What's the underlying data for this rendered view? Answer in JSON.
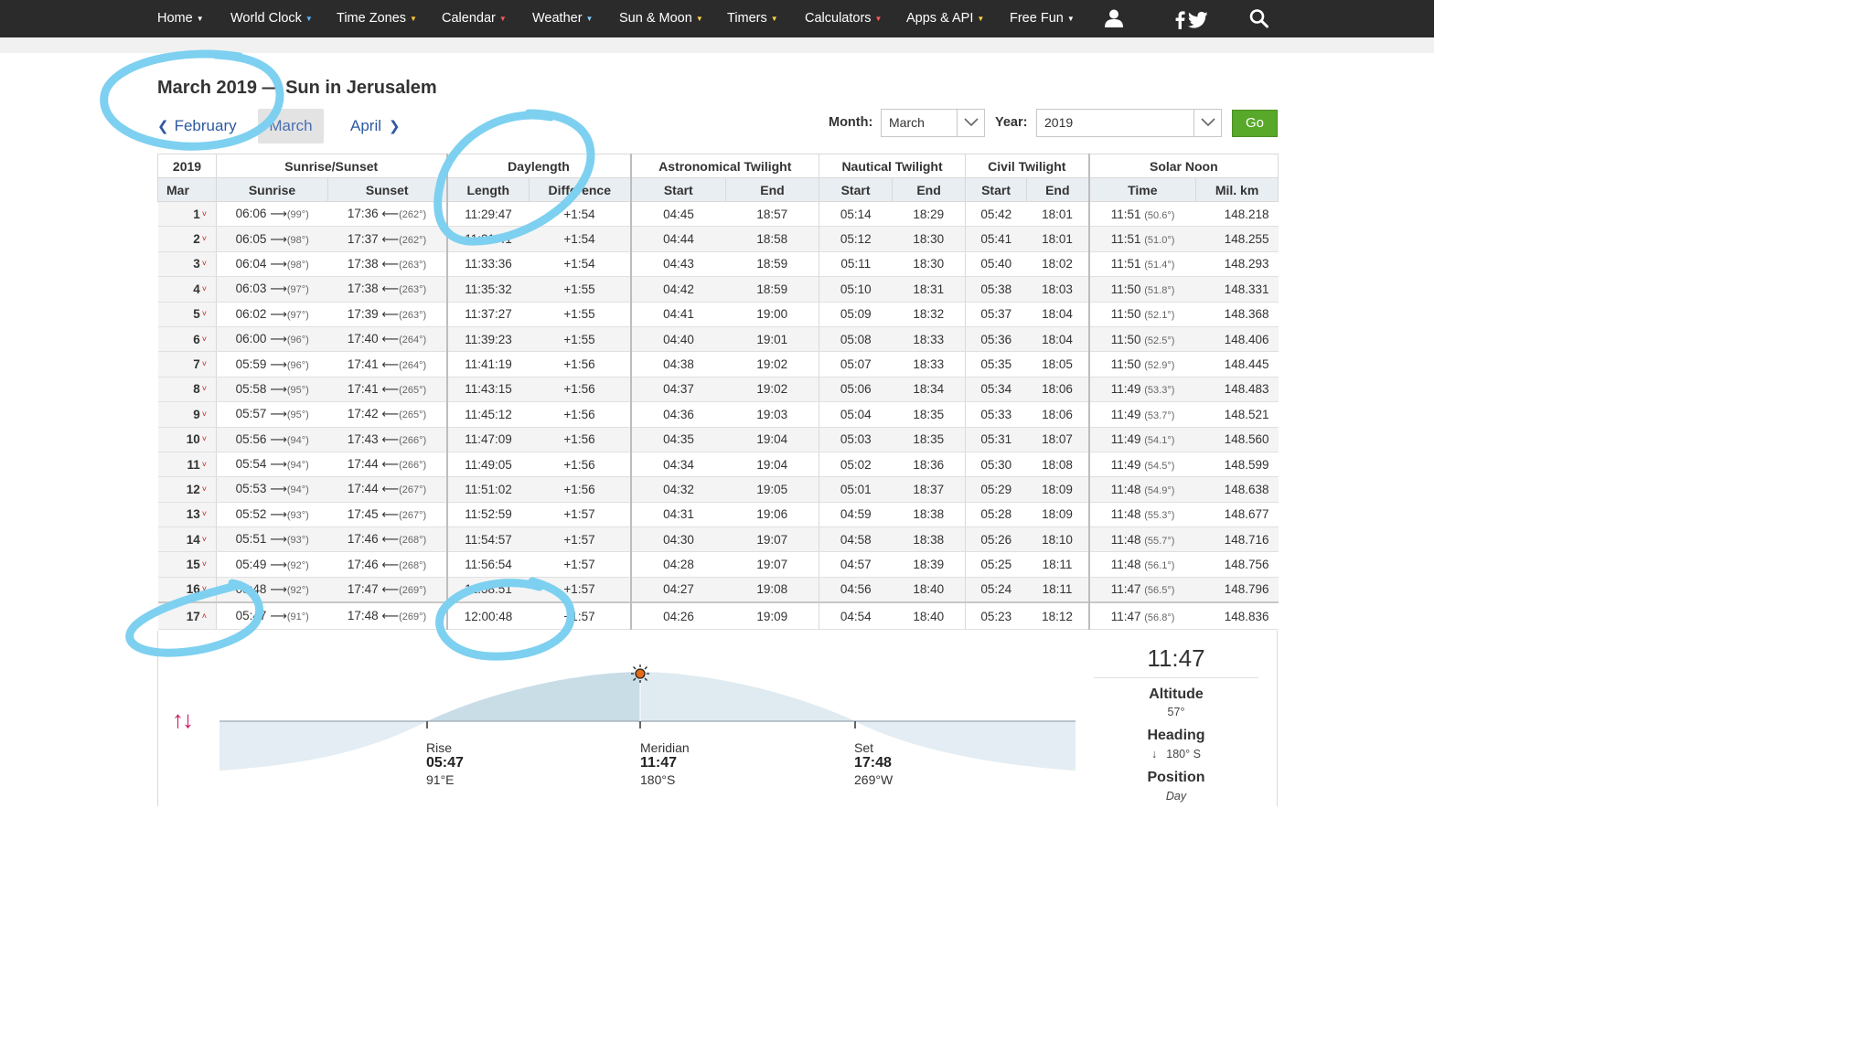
{
  "nav": {
    "items": [
      {
        "label": "Home"
      },
      {
        "label": "World Clock"
      },
      {
        "label": "Time Zones"
      },
      {
        "label": "Calendar"
      },
      {
        "label": "Weather"
      },
      {
        "label": "Sun & Moon"
      },
      {
        "label": "Timers"
      },
      {
        "label": "Calculators"
      },
      {
        "label": "Apps & API"
      },
      {
        "label": "Free Fun"
      }
    ],
    "icons": [
      "user-icon",
      "facebook-icon",
      "twitter-icon",
      "search-icon"
    ]
  },
  "header": {
    "title": "March 2019 — Sun in Jerusalem",
    "prev_month": "February",
    "current_month": "March",
    "next_month": "April"
  },
  "form": {
    "month_label": "Month:",
    "month_value": "March",
    "year_label": "Year:",
    "year_value": "2019",
    "go_label": "Go",
    "accent_color": "#58a829"
  },
  "table": {
    "group_headers": {
      "year": "2019",
      "sunrise_sunset": "Sunrise/Sunset",
      "daylength": "Daylength",
      "astro": "Astronomical Twilight",
      "nautical": "Nautical Twilight",
      "civil": "Civil Twilight",
      "solar_noon": "Solar Noon"
    },
    "sub_headers": {
      "month": "Mar",
      "sunrise": "Sunrise",
      "sunset": "Sunset",
      "length": "Length",
      "difference": "Difference",
      "astro_start": "Start",
      "astro_end": "End",
      "naut_start": "Start",
      "naut_end": "End",
      "civil_start": "Start",
      "civil_end": "End",
      "noon_time": "Time",
      "mil_km": "Mil. km"
    },
    "rows": [
      {
        "day": "1",
        "rise": "06:06",
        "rise_az": "(99°)",
        "set": "17:36",
        "set_az": "(262°)",
        "len": "11:29:47",
        "diff": "+1:54",
        "as": "04:45",
        "ae": "18:57",
        "ns": "05:14",
        "ne": "18:29",
        "cs": "05:42",
        "ce": "18:01",
        "noon": "11:51",
        "noon_alt": "(50.6°)",
        "km": "148.218"
      },
      {
        "day": "2",
        "rise": "06:05",
        "rise_az": "(98°)",
        "set": "17:37",
        "set_az": "(262°)",
        "len": "11:31:41",
        "diff": "+1:54",
        "as": "04:44",
        "ae": "18:58",
        "ns": "05:12",
        "ne": "18:30",
        "cs": "05:41",
        "ce": "18:01",
        "noon": "11:51",
        "noon_alt": "(51.0°)",
        "km": "148.255"
      },
      {
        "day": "3",
        "rise": "06:04",
        "rise_az": "(98°)",
        "set": "17:38",
        "set_az": "(263°)",
        "len": "11:33:36",
        "diff": "+1:54",
        "as": "04:43",
        "ae": "18:59",
        "ns": "05:11",
        "ne": "18:30",
        "cs": "05:40",
        "ce": "18:02",
        "noon": "11:51",
        "noon_alt": "(51.4°)",
        "km": "148.293"
      },
      {
        "day": "4",
        "rise": "06:03",
        "rise_az": "(97°)",
        "set": "17:38",
        "set_az": "(263°)",
        "len": "11:35:32",
        "diff": "+1:55",
        "as": "04:42",
        "ae": "18:59",
        "ns": "05:10",
        "ne": "18:31",
        "cs": "05:38",
        "ce": "18:03",
        "noon": "11:50",
        "noon_alt": "(51.8°)",
        "km": "148.331"
      },
      {
        "day": "5",
        "rise": "06:02",
        "rise_az": "(97°)",
        "set": "17:39",
        "set_az": "(263°)",
        "len": "11:37:27",
        "diff": "+1:55",
        "as": "04:41",
        "ae": "19:00",
        "ns": "05:09",
        "ne": "18:32",
        "cs": "05:37",
        "ce": "18:04",
        "noon": "11:50",
        "noon_alt": "(52.1°)",
        "km": "148.368"
      },
      {
        "day": "6",
        "rise": "06:00",
        "rise_az": "(96°)",
        "set": "17:40",
        "set_az": "(264°)",
        "len": "11:39:23",
        "diff": "+1:55",
        "as": "04:40",
        "ae": "19:01",
        "ns": "05:08",
        "ne": "18:33",
        "cs": "05:36",
        "ce": "18:04",
        "noon": "11:50",
        "noon_alt": "(52.5°)",
        "km": "148.406"
      },
      {
        "day": "7",
        "rise": "05:59",
        "rise_az": "(96°)",
        "set": "17:41",
        "set_az": "(264°)",
        "len": "11:41:19",
        "diff": "+1:56",
        "as": "04:38",
        "ae": "19:02",
        "ns": "05:07",
        "ne": "18:33",
        "cs": "05:35",
        "ce": "18:05",
        "noon": "11:50",
        "noon_alt": "(52.9°)",
        "km": "148.445"
      },
      {
        "day": "8",
        "rise": "05:58",
        "rise_az": "(95°)",
        "set": "17:41",
        "set_az": "(265°)",
        "len": "11:43:15",
        "diff": "+1:56",
        "as": "04:37",
        "ae": "19:02",
        "ns": "05:06",
        "ne": "18:34",
        "cs": "05:34",
        "ce": "18:06",
        "noon": "11:49",
        "noon_alt": "(53.3°)",
        "km": "148.483"
      },
      {
        "day": "9",
        "rise": "05:57",
        "rise_az": "(95°)",
        "set": "17:42",
        "set_az": "(265°)",
        "len": "11:45:12",
        "diff": "+1:56",
        "as": "04:36",
        "ae": "19:03",
        "ns": "05:04",
        "ne": "18:35",
        "cs": "05:33",
        "ce": "18:06",
        "noon": "11:49",
        "noon_alt": "(53.7°)",
        "km": "148.521"
      },
      {
        "day": "10",
        "rise": "05:56",
        "rise_az": "(94°)",
        "set": "17:43",
        "set_az": "(266°)",
        "len": "11:47:09",
        "diff": "+1:56",
        "as": "04:35",
        "ae": "19:04",
        "ns": "05:03",
        "ne": "18:35",
        "cs": "05:31",
        "ce": "18:07",
        "noon": "11:49",
        "noon_alt": "(54.1°)",
        "km": "148.560"
      },
      {
        "day": "11",
        "rise": "05:54",
        "rise_az": "(94°)",
        "set": "17:44",
        "set_az": "(266°)",
        "len": "11:49:05",
        "diff": "+1:56",
        "as": "04:34",
        "ae": "19:04",
        "ns": "05:02",
        "ne": "18:36",
        "cs": "05:30",
        "ce": "18:08",
        "noon": "11:49",
        "noon_alt": "(54.5°)",
        "km": "148.599"
      },
      {
        "day": "12",
        "rise": "05:53",
        "rise_az": "(94°)",
        "set": "17:44",
        "set_az": "(267°)",
        "len": "11:51:02",
        "diff": "+1:56",
        "as": "04:32",
        "ae": "19:05",
        "ns": "05:01",
        "ne": "18:37",
        "cs": "05:29",
        "ce": "18:09",
        "noon": "11:48",
        "noon_alt": "(54.9°)",
        "km": "148.638"
      },
      {
        "day": "13",
        "rise": "05:52",
        "rise_az": "(93°)",
        "set": "17:45",
        "set_az": "(267°)",
        "len": "11:52:59",
        "diff": "+1:57",
        "as": "04:31",
        "ae": "19:06",
        "ns": "04:59",
        "ne": "18:38",
        "cs": "05:28",
        "ce": "18:09",
        "noon": "11:48",
        "noon_alt": "(55.3°)",
        "km": "148.677"
      },
      {
        "day": "14",
        "rise": "05:51",
        "rise_az": "(93°)",
        "set": "17:46",
        "set_az": "(268°)",
        "len": "11:54:57",
        "diff": "+1:57",
        "as": "04:30",
        "ae": "19:07",
        "ns": "04:58",
        "ne": "18:38",
        "cs": "05:26",
        "ce": "18:10",
        "noon": "11:48",
        "noon_alt": "(55.7°)",
        "km": "148.716"
      },
      {
        "day": "15",
        "rise": "05:49",
        "rise_az": "(92°)",
        "set": "17:46",
        "set_az": "(268°)",
        "len": "11:56:54",
        "diff": "+1:57",
        "as": "04:28",
        "ae": "19:07",
        "ns": "04:57",
        "ne": "18:39",
        "cs": "05:25",
        "ce": "18:11",
        "noon": "11:48",
        "noon_alt": "(56.1°)",
        "km": "148.756"
      },
      {
        "day": "16",
        "rise": "05:48",
        "rise_az": "(92°)",
        "set": "17:47",
        "set_az": "(269°)",
        "len": "11:58:51",
        "diff": "+1:57",
        "as": "04:27",
        "ae": "19:08",
        "ns": "04:56",
        "ne": "18:40",
        "cs": "05:24",
        "ce": "18:11",
        "noon": "11:47",
        "noon_alt": "(56.5°)",
        "km": "148.796"
      },
      {
        "day": "17",
        "rise": "05:47",
        "rise_az": "(91°)",
        "set": "17:48",
        "set_az": "(269°)",
        "len": "12:00:48",
        "diff": "+1:57",
        "as": "04:26",
        "ae": "19:09",
        "ns": "04:54",
        "ne": "18:40",
        "cs": "05:23",
        "ce": "18:12",
        "noon": "11:47",
        "noon_alt": "(56.8°)",
        "km": "148.836"
      }
    ]
  },
  "graph": {
    "rise": {
      "label": "Rise",
      "time": "05:47",
      "dir": "91°E"
    },
    "meridian": {
      "label": "Meridian",
      "time": "11:47",
      "dir": "180°S"
    },
    "set": {
      "label": "Set",
      "time": "17:48",
      "dir": "269°W"
    }
  },
  "side": {
    "time": "11:47",
    "altitude_label": "Altitude",
    "altitude": "57°",
    "heading_label": "Heading",
    "heading": "180° S",
    "position_label": "Position",
    "position": "Day"
  }
}
